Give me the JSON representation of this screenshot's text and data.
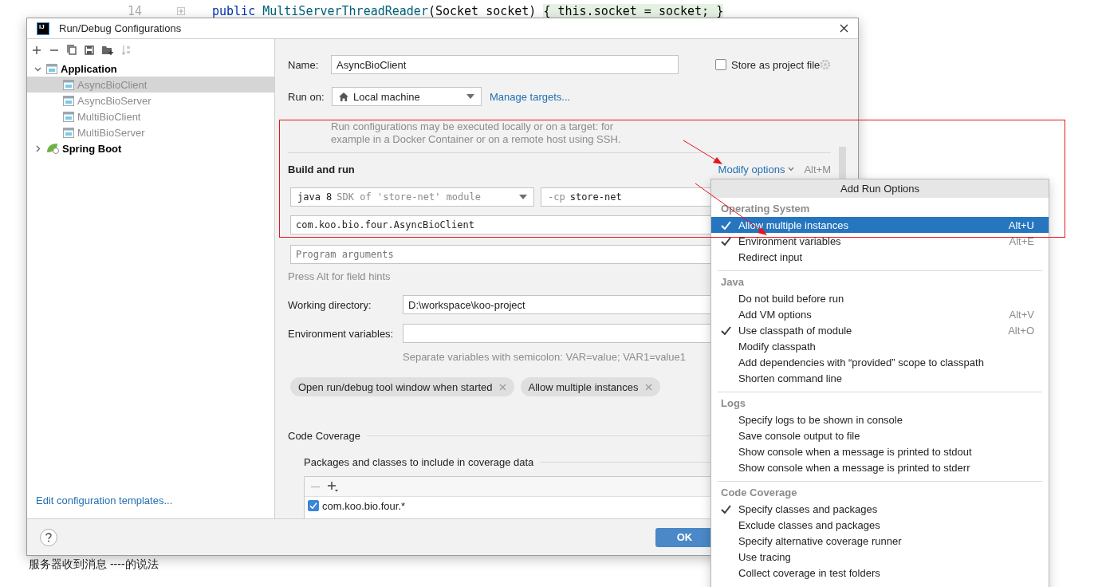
{
  "editor": {
    "line_number": "14",
    "code": [
      {
        "text": "public ",
        "kind": "keyword"
      },
      {
        "text": "MultiServerThreadReader",
        "kind": "method"
      },
      {
        "text": "(Socket socket) ",
        "kind": "plain"
      },
      {
        "text": "{ this.socket = socket; }",
        "kind": "folded"
      }
    ],
    "output_text": "服务器收到消息 ----的说法"
  },
  "dialog": {
    "logo": "IJ",
    "title": "Run/Debug Configurations",
    "tree": [
      {
        "label": "Application",
        "expanded": true,
        "selected": false,
        "children": [
          {
            "label": "AsyncBioClient",
            "selected": true
          },
          {
            "label": "AsyncBioServer",
            "selected": false
          },
          {
            "label": "MultiBioClient",
            "selected": false
          },
          {
            "label": "MultiBioServer",
            "selected": false
          }
        ]
      },
      {
        "label": "Spring Boot",
        "expanded": false,
        "selected": false
      }
    ],
    "templates_link": "Edit configuration templates...",
    "form": {
      "name": {
        "label": "Name:",
        "value": "AsyncBioClient"
      },
      "store_as_project_file": {
        "label": "Store as project file",
        "checked": false
      },
      "run_on": {
        "label": "Run on:",
        "value": "Local machine",
        "link": "Manage targets..."
      },
      "run_on_hint": [
        "Run configurations may be executed locally or on a target: for",
        "example in a Docker Container or on a remote host using SSH."
      ],
      "build_and_run": {
        "title": "Build and run",
        "modify_options": "Modify options",
        "shortcut": "Alt+M"
      },
      "sdk": {
        "value": "java 8",
        "hint": "SDK of 'store-net' module"
      },
      "classpath": {
        "prefix": "-cp",
        "value": "store-net"
      },
      "main_class": "com.koo.bio.four.AsyncBioClient",
      "program_arguments": {
        "placeholder": "Program arguments"
      },
      "field_hint": "Press Alt for field hints",
      "working_directory": {
        "label": "Working directory:",
        "value": "D:\\workspace\\koo-project"
      },
      "environment_variables": {
        "label": "Environment variables:",
        "hint": "Separate variables with semicolon: VAR=value; VAR1=value1"
      },
      "chips": [
        "Open run/debug tool window when started",
        "Allow multiple instances"
      ],
      "code_coverage": {
        "title": "Code Coverage",
        "packages_title": "Packages and classes to include in coverage data",
        "patterns": [
          {
            "pattern": "com.koo.bio.four.*",
            "checked": true
          }
        ]
      }
    },
    "ok": "OK"
  },
  "popup": {
    "title": "Add Run Options",
    "sections": [
      {
        "title": "Operating System",
        "items": [
          {
            "label": "Allow multiple instances",
            "shortcut": "Alt+U",
            "checked": true,
            "selected": true
          },
          {
            "label": "Environment variables",
            "shortcut": "Alt+E",
            "checked": true,
            "selected": false
          },
          {
            "label": "Redirect input",
            "checked": false,
            "selected": false
          }
        ]
      },
      {
        "title": "Java",
        "items": [
          {
            "label": "Do not build before run",
            "checked": false,
            "selected": false
          },
          {
            "label": "Add VM options",
            "shortcut": "Alt+V",
            "checked": false,
            "selected": false
          },
          {
            "label": "Use classpath of module",
            "shortcut": "Alt+O",
            "checked": true,
            "selected": false
          },
          {
            "label": "Modify classpath",
            "checked": false,
            "selected": false
          },
          {
            "label": "Add dependencies with “provided” scope to classpath",
            "checked": false,
            "selected": false
          },
          {
            "label": "Shorten command line",
            "checked": false,
            "selected": false
          }
        ]
      },
      {
        "title": "Logs",
        "items": [
          {
            "label": "Specify logs to be shown in console",
            "checked": false,
            "selected": false
          },
          {
            "label": "Save console output to file",
            "checked": false,
            "selected": false
          },
          {
            "label": "Show console when a message is printed to stdout",
            "checked": false,
            "selected": false
          },
          {
            "label": "Show console when a message is printed to stderr",
            "checked": false,
            "selected": false
          }
        ]
      },
      {
        "title": "Code Coverage",
        "items": [
          {
            "label": "Specify classes and packages",
            "checked": true,
            "selected": false
          },
          {
            "label": "Exclude classes and packages",
            "checked": false,
            "selected": false
          },
          {
            "label": "Specify alternative coverage runner",
            "checked": false,
            "selected": false
          },
          {
            "label": "Use tracing",
            "checked": false,
            "selected": false
          },
          {
            "label": "Collect coverage in test folders",
            "checked": false,
            "selected": false
          }
        ]
      }
    ]
  }
}
